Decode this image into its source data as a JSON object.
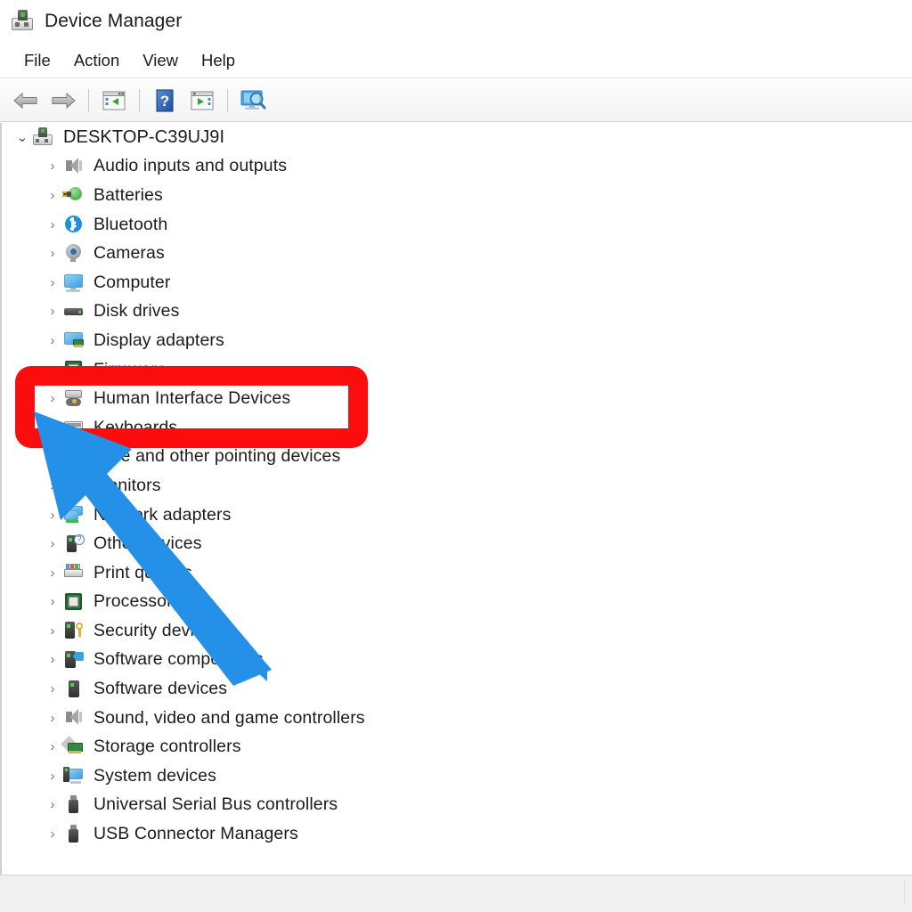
{
  "window": {
    "title": "Device Manager",
    "title_icon": "device-manager-icon"
  },
  "menubar": {
    "items": [
      {
        "label": "File"
      },
      {
        "label": "Action"
      },
      {
        "label": "View"
      },
      {
        "label": "Help"
      }
    ]
  },
  "toolbar": {
    "buttons": [
      {
        "name": "back-button",
        "icon": "back-arrow-icon",
        "tooltip": "Back"
      },
      {
        "name": "forward-button",
        "icon": "forward-arrow-icon",
        "tooltip": "Forward"
      },
      {
        "name": "properties-button",
        "icon": "properties-icon",
        "tooltip": "Properties"
      },
      {
        "name": "help-button",
        "icon": "help-question-icon",
        "tooltip": "Help"
      },
      {
        "name": "update-driver-button",
        "icon": "update-driver-icon",
        "tooltip": "Update driver"
      },
      {
        "name": "scan-hardware-button",
        "icon": "scan-for-hardware-changes-icon",
        "tooltip": "Scan for hardware changes"
      }
    ]
  },
  "tree": {
    "root": {
      "label": "DESKTOP-C39UJ9I",
      "expanded": true,
      "chevron": "chevron-down",
      "icon": "computer-root-icon"
    },
    "items": [
      {
        "label": "Audio inputs and outputs",
        "icon": "speaker-icon",
        "chevron": "chevron-right"
      },
      {
        "label": "Batteries",
        "icon": "battery-icon",
        "chevron": "chevron-right"
      },
      {
        "label": "Bluetooth",
        "icon": "bluetooth-icon",
        "chevron": "chevron-right"
      },
      {
        "label": "Cameras",
        "icon": "camera-icon",
        "chevron": "chevron-right"
      },
      {
        "label": "Computer",
        "icon": "monitor-icon",
        "chevron": "chevron-right"
      },
      {
        "label": "Disk drives",
        "icon": "disk-drive-icon",
        "chevron": "chevron-right"
      },
      {
        "label": "Display adapters",
        "icon": "display-adapter-icon",
        "chevron": "chevron-right"
      },
      {
        "label": "Firmware",
        "icon": "firmware-icon",
        "chevron": "chevron-right",
        "occluded": true
      },
      {
        "label": "Human Interface Devices",
        "icon": "human-interface-device-icon",
        "chevron": "chevron-right",
        "highlighted": true
      },
      {
        "label": "Keyboards",
        "icon": "keyboard-icon",
        "chevron": "chevron-right"
      },
      {
        "label": "Mice and other pointing devices",
        "icon": "mouse-icon",
        "chevron": "chevron-right"
      },
      {
        "label": "Monitors",
        "icon": "monitor-icon",
        "chevron": "chevron-right"
      },
      {
        "label": "Network adapters",
        "icon": "network-adapter-icon",
        "chevron": "chevron-right"
      },
      {
        "label": "Other devices",
        "icon": "other-device-icon",
        "chevron": "chevron-right"
      },
      {
        "label": "Print queues",
        "icon": "printer-icon",
        "chevron": "chevron-right"
      },
      {
        "label": "Processors",
        "icon": "processor-icon",
        "chevron": "chevron-right"
      },
      {
        "label": "Security devices",
        "icon": "security-device-icon",
        "chevron": "chevron-right"
      },
      {
        "label": "Software components",
        "icon": "software-component-icon",
        "chevron": "chevron-right"
      },
      {
        "label": "Software devices",
        "icon": "software-device-icon",
        "chevron": "chevron-right"
      },
      {
        "label": "Sound, video and game controllers",
        "icon": "speaker-icon",
        "chevron": "chevron-right"
      },
      {
        "label": "Storage controllers",
        "icon": "storage-controller-icon",
        "chevron": "chevron-right"
      },
      {
        "label": "System devices",
        "icon": "system-device-icon",
        "chevron": "chevron-right"
      },
      {
        "label": "Universal Serial Bus controllers",
        "icon": "usb-icon",
        "chevron": "chevron-right"
      },
      {
        "label": "USB Connector Managers",
        "icon": "usb-icon",
        "chevron": "chevron-right"
      }
    ]
  },
  "annotations": {
    "highlight_box": {
      "target": "Human Interface Devices",
      "color": "#fb0d0d",
      "shape": "rounded-rectangle"
    },
    "pointer_arrow": {
      "target": "Human Interface Devices",
      "color": "#2490e8",
      "direction": "up-left"
    }
  },
  "statusbar": {
    "text": ""
  }
}
